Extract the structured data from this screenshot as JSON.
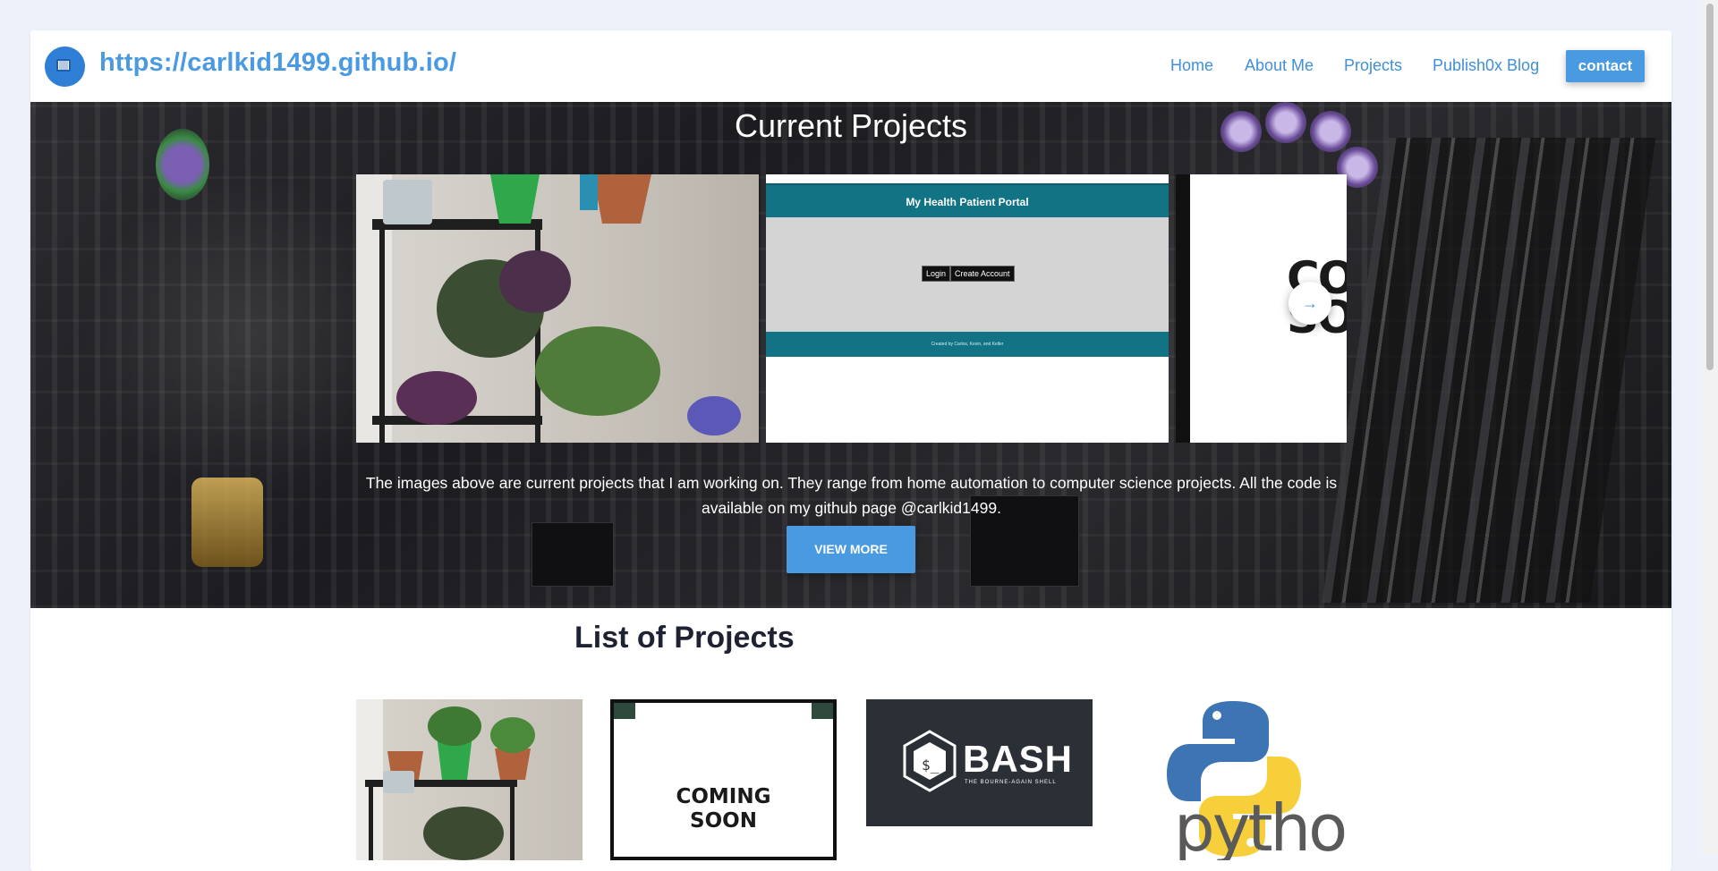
{
  "header": {
    "site_url": "https://carlkid1499.github.io/",
    "logo_icon": "window-icon",
    "nav": {
      "home": "Home",
      "about": "About Me",
      "projects": "Projects",
      "blog": "Publish0x Blog",
      "contact": "contact"
    }
  },
  "hero": {
    "title": "Current Projects",
    "carousel": {
      "slide_portal": {
        "title": "My Health Patient Portal",
        "login": "Login",
        "create_account": "Create Account",
        "footer": "Created by Carlos, Kevin, and Keller"
      },
      "slide_soon": {
        "text_line1": "CO",
        "text_line2": "SO"
      },
      "next_icon": "arrow-right-icon"
    },
    "description": "The images above are current projects that I am working on.  They range from home automation to computer science projects.  All the code is available on my github page @carlkid1499.",
    "view_more": "VIEW MORE"
  },
  "projects_list": {
    "title": "List of Projects",
    "items": [
      {
        "name": "plants"
      },
      {
        "name": "coming-soon",
        "line1": "COMING",
        "line2": "SOON"
      },
      {
        "name": "bash",
        "word": "BASH",
        "tagline": "THE BOURNE-AGAIN SHELL",
        "prompt": "$_"
      },
      {
        "name": "python",
        "word": "python"
      }
    ]
  },
  "colors": {
    "accent": "#4a9ae2",
    "portal_teal": "#117384",
    "page_bg": "#edf1fa",
    "heading": "#1e2233"
  }
}
